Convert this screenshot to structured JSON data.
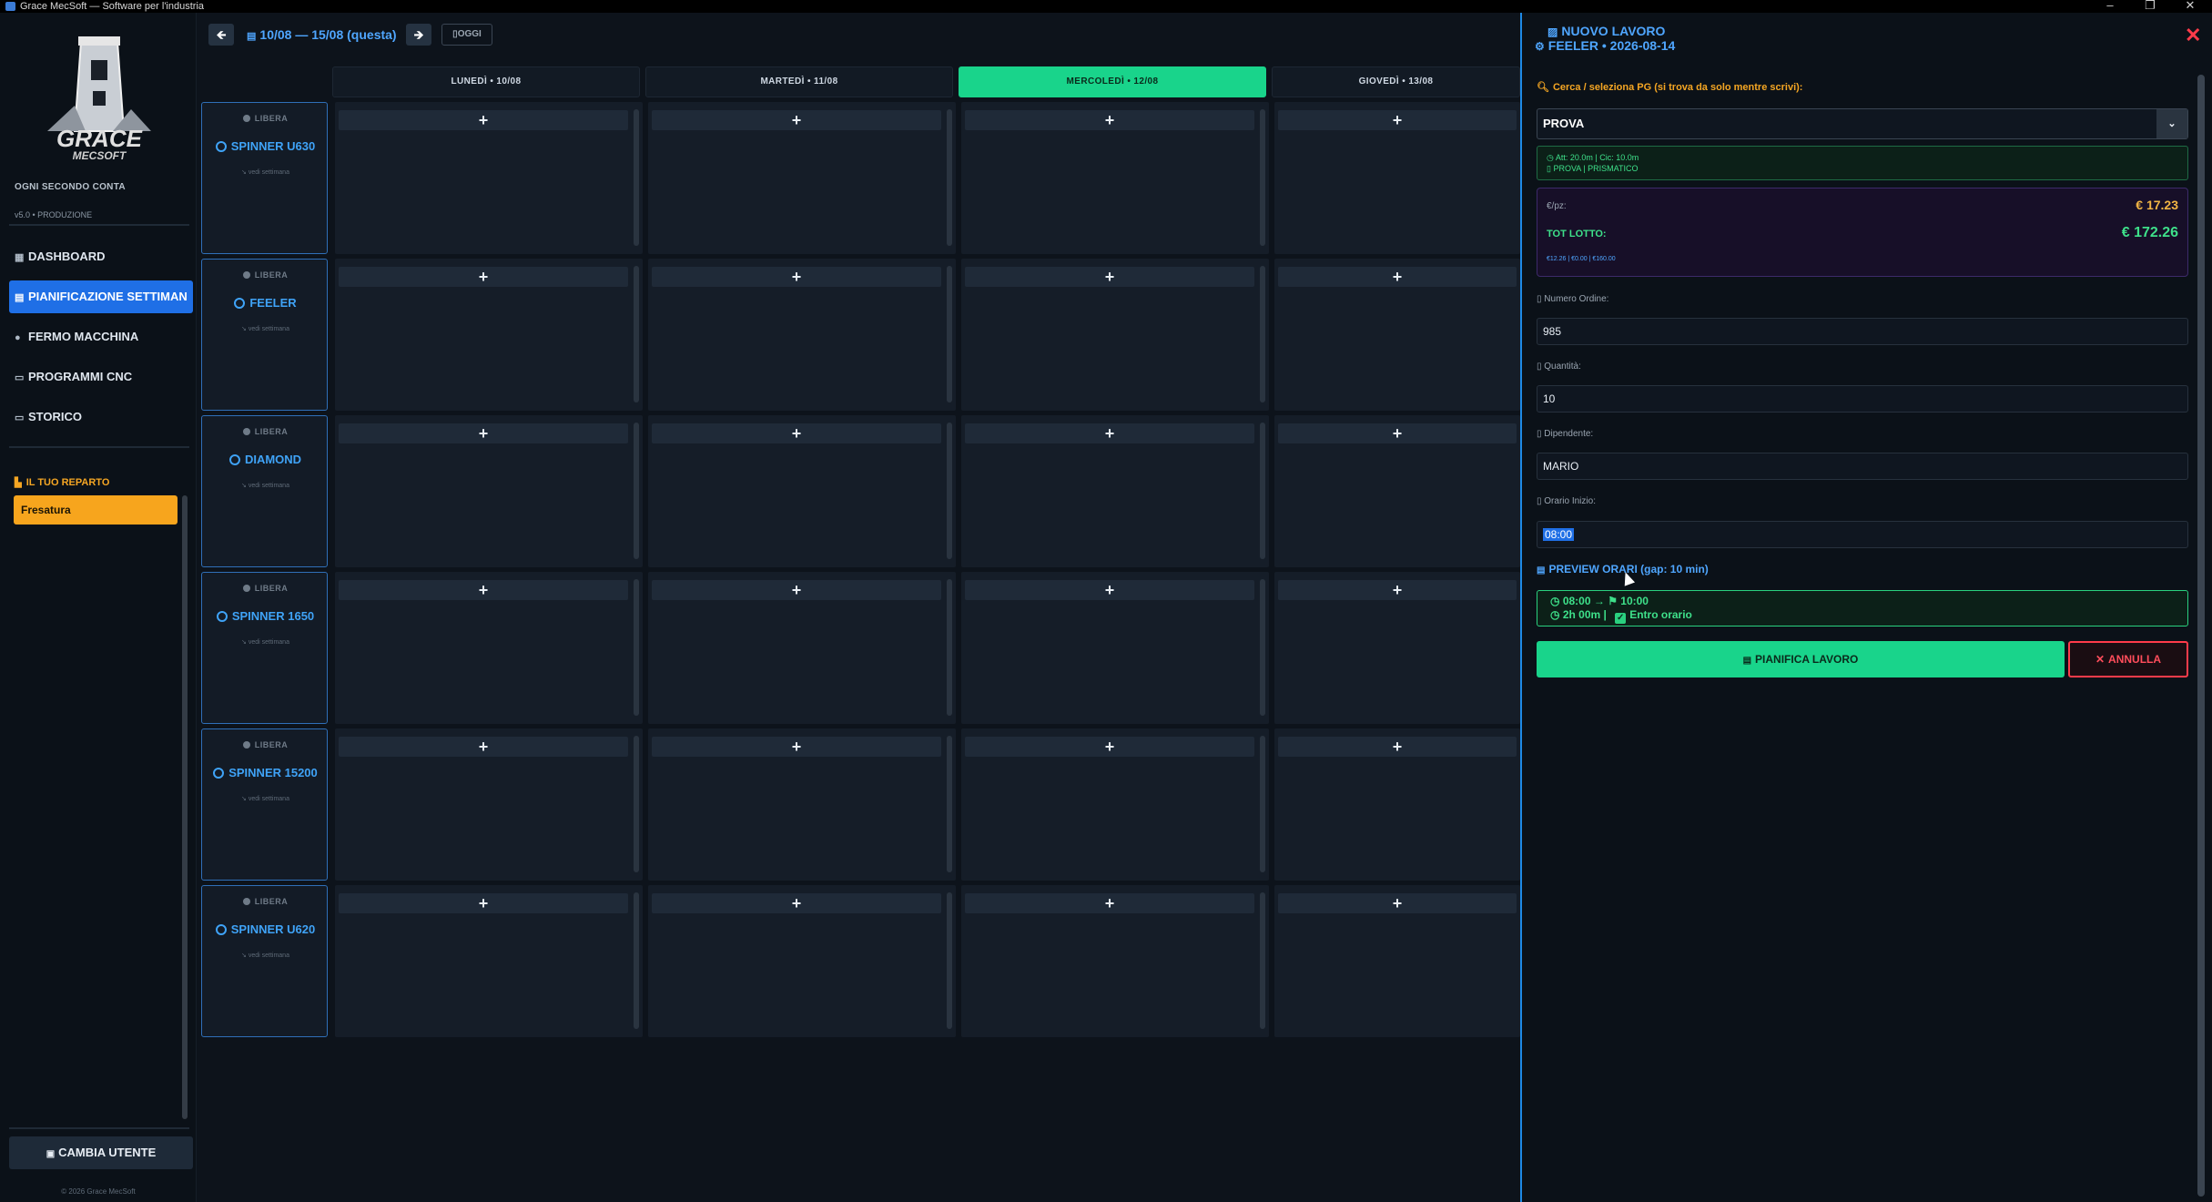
{
  "window": {
    "title": "Grace MecSoft — Software per l'industria"
  },
  "sidebar": {
    "company": "OGNI SECONDO CONTA",
    "version": "v5.0 • PRODUZIONE",
    "nav": [
      {
        "label": "DASHBOARD",
        "icon": "dashboard-icon"
      },
      {
        "label": "PIANIFICAZIONE SETTIMAN",
        "icon": "calendar-icon",
        "active": true
      },
      {
        "label": "FERMO MACCHINA",
        "icon": "dot-icon"
      },
      {
        "label": "PROGRAMMI CNC",
        "icon": "folder-icon"
      },
      {
        "label": "STORICO",
        "icon": "history-icon"
      }
    ],
    "reparto_title": "IL TUO REPARTO",
    "reparto_value": "Fresatura",
    "change_user": "CAMBIA UTENTE",
    "copyright": "© 2026 Grace MecSoft"
  },
  "toolbar": {
    "week_label": "10/08 — 15/08 (questa)",
    "today_label": "OGGI"
  },
  "days": [
    {
      "label": "LUNEDÌ • 10/08",
      "today": false
    },
    {
      "label": "MARTEDÌ • 11/08",
      "today": false
    },
    {
      "label": "MERCOLEDÌ • 12/08",
      "today": true
    },
    {
      "label": "GIOVEDÌ • 13/08",
      "today": false
    }
  ],
  "machines": [
    {
      "name": "SPINNER U630",
      "status": "LIBERA",
      "sub": "↘ vedi settimana"
    },
    {
      "name": "FEELER",
      "status": "LIBERA",
      "sub": "↘ vedi settimana"
    },
    {
      "name": "DIAMOND",
      "status": "LIBERA",
      "sub": "↘ vedi settimana"
    },
    {
      "name": "SPINNER 1650",
      "status": "LIBERA",
      "sub": "↘ vedi settimana"
    },
    {
      "name": "SPINNER 15200",
      "status": "LIBERA",
      "sub": "↘ vedi settimana"
    },
    {
      "name": "SPINNER U620",
      "status": "LIBERA",
      "sub": "↘ vedi settimana"
    }
  ],
  "add_symbol": "+",
  "panel": {
    "title": "NUOVO LAVORO",
    "subtitle": "FEELER • 2026-08-14",
    "search_label": "Cerca / seleziona PG (si trova da solo mentre scrivi):",
    "selected": "PROVA",
    "info_line1": "Att: 20.0m | Cic: 10.0m",
    "info_line2": "PROVA | PRISMATICO",
    "price_label": "€/pz:",
    "price_value": "€ 17.23",
    "total_label": "TOT LOTTO:",
    "total_value": "€ 172.26",
    "breakdown": "€12.26 | €0.00 | €160.00",
    "order_label": "Numero Ordine:",
    "order_value": "985",
    "qty_label": "Quantità:",
    "qty_value": "10",
    "employee_label": "Dipendente:",
    "employee_value": "MARIO",
    "start_label": "Orario Inizio:",
    "start_value": "08:00",
    "preview_title": "PREVIEW ORARI (gap: 10 min)",
    "preview_start": "08:00",
    "preview_end": "10:00",
    "preview_duration": "2h 00m",
    "preview_status": "Entro orario",
    "plan_button": "PIANIFICA LAVORO",
    "cancel_button": "ANNULLA"
  },
  "colors": {
    "accent": "#1f6fe6",
    "today": "#19d48b",
    "reparto": "#f7a51d",
    "danger": "#ff3b4a"
  }
}
